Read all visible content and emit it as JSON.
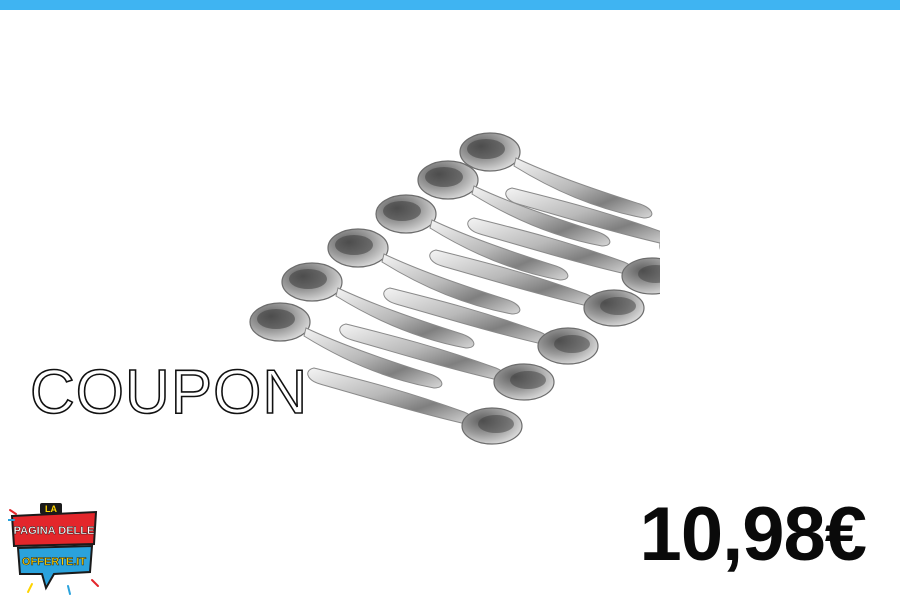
{
  "header": {
    "accent_color": "#3fb4f2"
  },
  "product": {
    "image": "teaspoon-set-image"
  },
  "coupon": {
    "label": "COUPON"
  },
  "price": {
    "value": "10,98€"
  },
  "logo": {
    "line1": "LA",
    "line2": "PAGINA DELLE",
    "line3": "OFFERTE.IT"
  }
}
